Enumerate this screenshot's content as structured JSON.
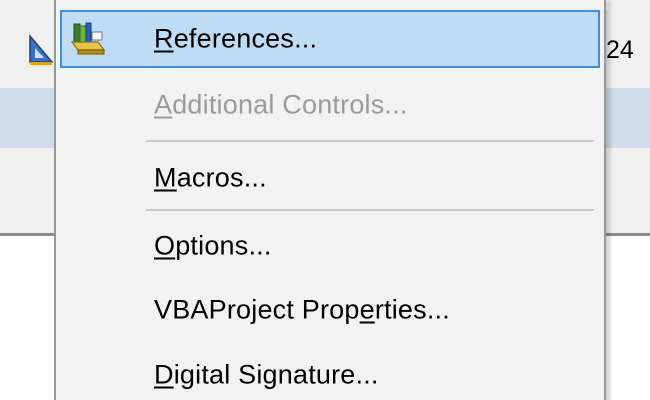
{
  "background": {
    "toolbar_number": "24"
  },
  "menu": {
    "items": [
      {
        "before": "",
        "key": "R",
        "after": "eferences...",
        "enabled": true,
        "highlighted": true,
        "icon": "references-icon"
      },
      {
        "before": "",
        "key": "A",
        "after": "dditional Controls...",
        "enabled": false,
        "highlighted": false,
        "icon": ""
      },
      {
        "before": "",
        "key": "M",
        "after": "acros...",
        "enabled": true,
        "highlighted": false,
        "icon": ""
      },
      {
        "before": "",
        "key": "O",
        "after": "ptions...",
        "enabled": true,
        "highlighted": false,
        "icon": ""
      },
      {
        "before": "VBAProject Prop",
        "key": "e",
        "after": "rties...",
        "enabled": true,
        "highlighted": false,
        "icon": ""
      },
      {
        "before": "",
        "key": "D",
        "after": "igital Signature...",
        "enabled": true,
        "highlighted": false,
        "icon": ""
      }
    ]
  },
  "colors": {
    "highlight_fill": "#bfdcf5",
    "highlight_border": "#3d8ee0",
    "disabled_text": "#9a9a9a",
    "menu_background": "#f2f2f2"
  }
}
